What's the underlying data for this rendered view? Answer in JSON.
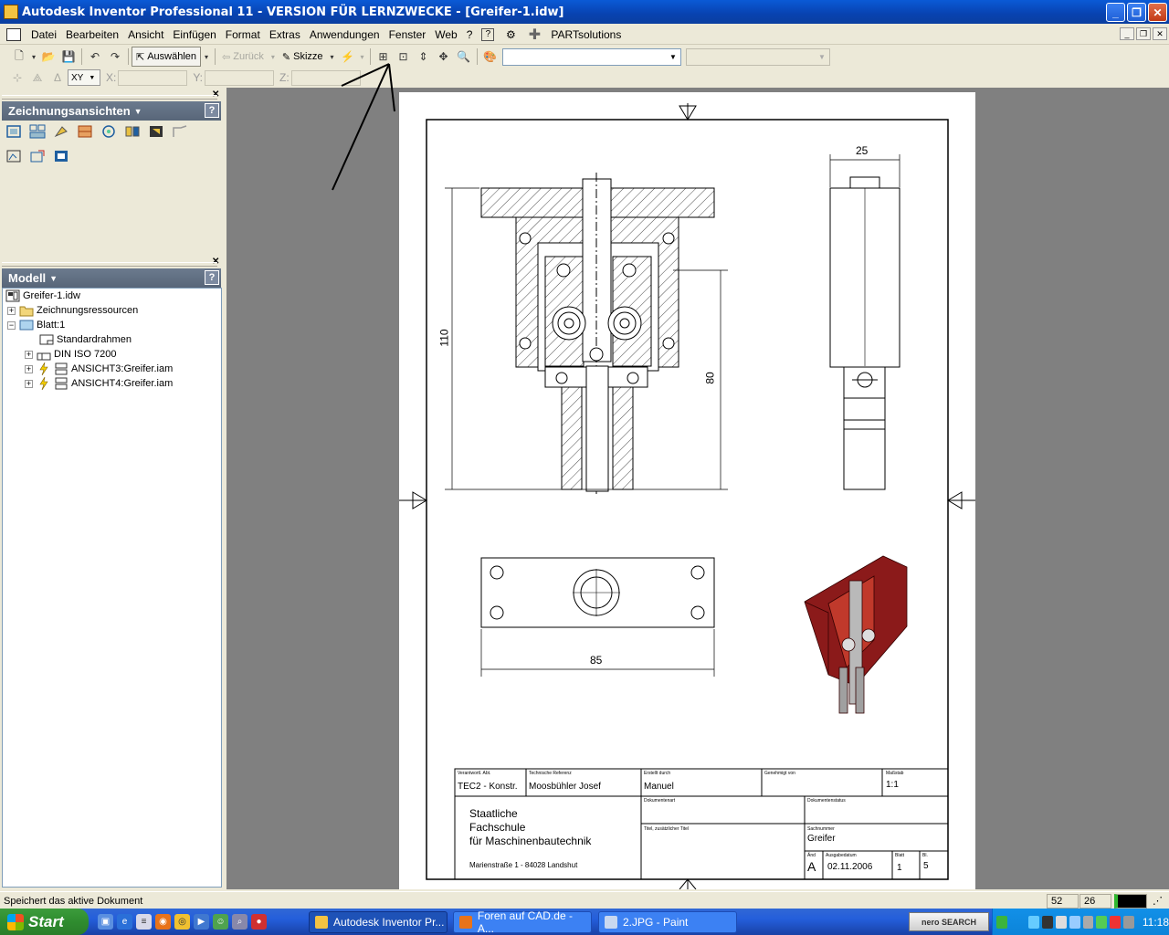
{
  "window": {
    "title": "Autodesk Inventor Professional 11 - VERSION FÜR LERNZWECKE - [Greifer-1.idw]"
  },
  "menu": {
    "items": [
      "Datei",
      "Bearbeiten",
      "Ansicht",
      "Einfügen",
      "Format",
      "Extras",
      "Anwendungen",
      "Fenster",
      "Web",
      "?"
    ],
    "partsolutions": "PARTsolutions"
  },
  "toolbar": {
    "select_label": "Auswählen",
    "back_label": "Zurück",
    "sketch_label": "Skizze"
  },
  "coordinate_bar": {
    "plane": "XY",
    "x_label": "X:",
    "y_label": "Y:",
    "z_label": "Z:"
  },
  "panel_views": {
    "title": "Zeichnungsansichten",
    "help": "?"
  },
  "panel_model": {
    "title": "Modell",
    "help": "?",
    "tree": [
      {
        "label": "Greifer-1.idw"
      },
      {
        "label": "Zeichnungsressourcen"
      },
      {
        "label": "Blatt:1"
      },
      {
        "label": "Standardrahmen"
      },
      {
        "label": "DIN ISO 7200"
      },
      {
        "label": "ANSICHT3:Greifer.iam"
      },
      {
        "label": "ANSICHT4:Greifer.iam"
      }
    ]
  },
  "drawing": {
    "dims": {
      "width_top": "25",
      "height_left": "110",
      "height_right": "80",
      "width_bottom": "85"
    },
    "title_block": {
      "lbl_verantwortl": "Verantwortl. Abt.",
      "val_verantwortl": "TEC2 - Konstr.",
      "lbl_tech_ref": "Technische Referenz",
      "val_tech_ref": "Moosbühler Josef",
      "lbl_erstellt": "Erstellt durch",
      "val_erstellt": "Manuel",
      "lbl_genehmigt": "Genehmigt von",
      "lbl_massstab": "Maßstab",
      "val_massstab": "1:1",
      "school_line1": "Staatliche",
      "school_line2": "Fachschule",
      "school_line3": "für Maschinenbautechnik",
      "school_address": "Marienstraße 1 - 84028 Landshut",
      "lbl_dokumentenart": "Dokumentenart",
      "lbl_dokumentenstatus": "Dokumentenstatus",
      "lbl_titel": "Titel, zusätzlicher Titel",
      "lbl_sachnummer": "Sachnummer",
      "val_sachnummer": "Greifer",
      "lbl_aend": "Änd",
      "val_aend": "A",
      "lbl_ausgabedatum": "Ausgabedatum",
      "val_ausgabedatum": "02.11.2006",
      "lbl_blatt": "Blatt",
      "val_blatt": "1",
      "lbl_bl": "Bl.",
      "val_bl": "5"
    }
  },
  "status": {
    "message": "Speichert das aktive Dokument",
    "x": "52",
    "y": "26"
  },
  "taskbar": {
    "start": "Start",
    "tasks": [
      "Autodesk Inventor Pr...",
      "Foren auf CAD.de - A...",
      "2.JPG - Paint"
    ],
    "nero": "nero SEARCH",
    "clock": "11:18"
  },
  "colors": {
    "title_bar": "#0a5ad6",
    "panel_header": "#6b7a8e",
    "canvas": "#808080",
    "model_red": "#8b1a1a"
  }
}
